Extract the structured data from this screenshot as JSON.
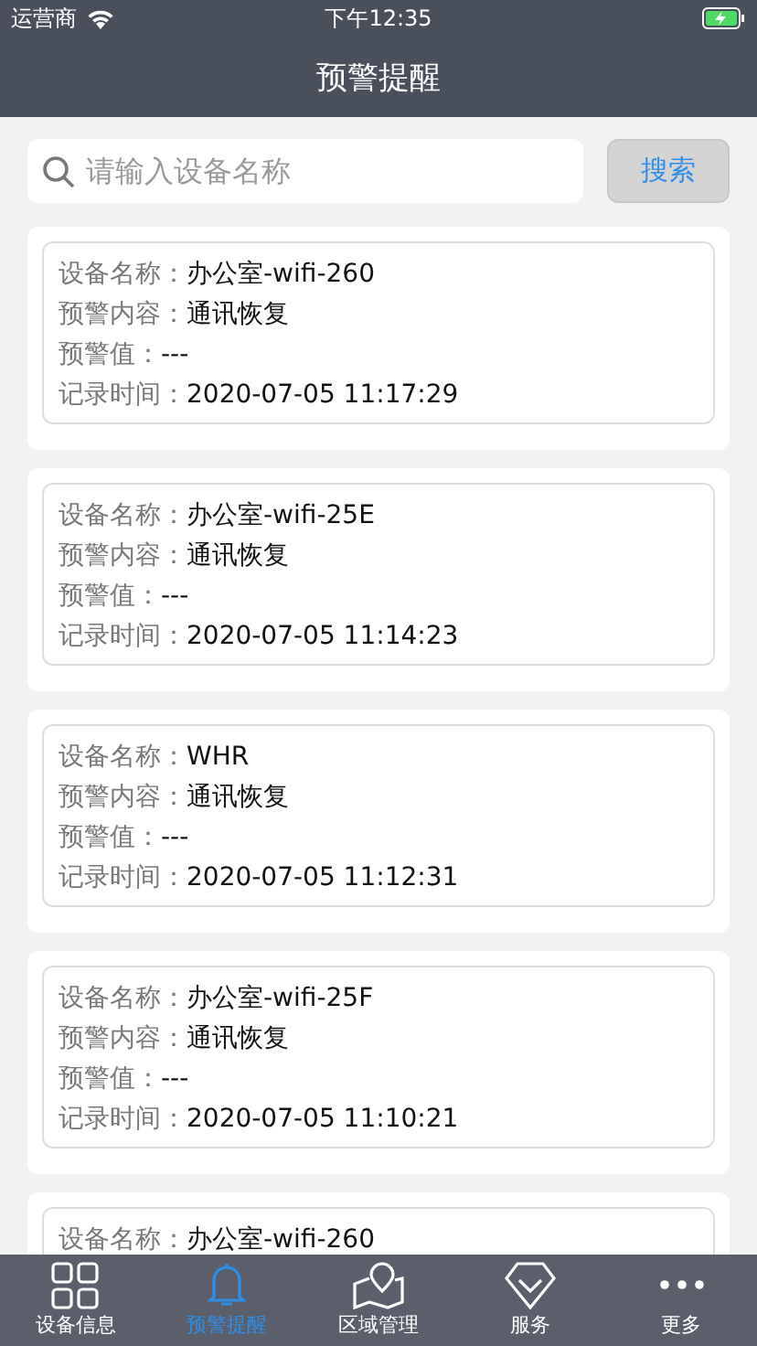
{
  "status_bar": {
    "carrier": "运营商",
    "time": "下午12:35"
  },
  "nav": {
    "title": "预警提醒"
  },
  "search": {
    "placeholder": "请输入设备名称",
    "button": "搜索"
  },
  "alerts": [
    {
      "lines": [
        {
          "caption": "设备名称：",
          "text": "办公室-wifi-260"
        },
        {
          "caption": "预警内容：",
          "text": "通讯恢复"
        },
        {
          "caption": "预警值：",
          "text": "---"
        },
        {
          "caption": "记录时间：",
          "text": "2020-07-05 11:17:29"
        }
      ]
    },
    {
      "lines": [
        {
          "caption": "设备名称：",
          "text": "办公室-wifi-25E"
        },
        {
          "caption": "预警内容：",
          "text": "通讯恢复"
        },
        {
          "caption": "预警值：",
          "text": "---"
        },
        {
          "caption": "记录时间：",
          "text": "2020-07-05 11:14:23"
        }
      ]
    },
    {
      "lines": [
        {
          "caption": "设备名称：",
          "text": "WHR"
        },
        {
          "caption": "预警内容：",
          "text": "通讯恢复"
        },
        {
          "caption": "预警值：",
          "text": "---"
        },
        {
          "caption": "记录时间：",
          "text": "2020-07-05 11:12:31"
        }
      ]
    },
    {
      "lines": [
        {
          "caption": "设备名称：",
          "text": "办公室-wifi-25F"
        },
        {
          "caption": "预警内容：",
          "text": "通讯恢复"
        },
        {
          "caption": "预警值：",
          "text": "---"
        },
        {
          "caption": "记录时间：",
          "text": "2020-07-05 11:10:21"
        }
      ]
    },
    {
      "lines": [
        {
          "caption": "设备名称：",
          "text": "办公室-wifi-260"
        }
      ]
    }
  ],
  "tabs": [
    {
      "kind": "grid",
      "label": "设备信息",
      "selected": false
    },
    {
      "kind": "bell",
      "label": "预警提醒",
      "selected": true
    },
    {
      "kind": "map",
      "label": "区域管理",
      "selected": false
    },
    {
      "kind": "diamond",
      "label": "服务",
      "selected": false
    },
    {
      "kind": "more",
      "label": "更多",
      "selected": false
    }
  ]
}
